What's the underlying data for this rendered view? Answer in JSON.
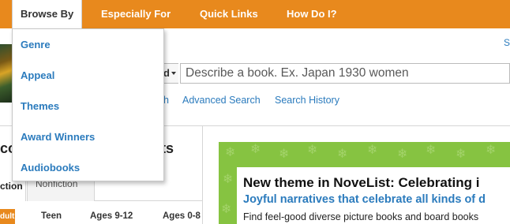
{
  "topnav": {
    "items": [
      {
        "label": "Browse By"
      },
      {
        "label": "Especially For"
      },
      {
        "label": "Quick Links"
      },
      {
        "label": "How Do I?"
      }
    ]
  },
  "header": {
    "sign_fragment": "S"
  },
  "search": {
    "type_fragment": "d",
    "placeholder": "Describe a book. Ex. Japan 1930 women",
    "fragment_left": "h",
    "advanced_link": "Advanced Search",
    "history_link": "Search History"
  },
  "left_panel": {
    "title_fragment": "co",
    "title_fragment_right": "ts",
    "tabs": [
      {
        "label": "ction"
      },
      {
        "label": "Nonfiction"
      }
    ],
    "age_badge": "dult",
    "age_links": [
      {
        "label": "Teen"
      },
      {
        "label": "Ages 9-12"
      },
      {
        "label": "Ages 0-8"
      }
    ]
  },
  "promo": {
    "title": "New theme in NoveList: Celebrating i",
    "subtitle": "Joyful narratives that celebrate all kinds of d",
    "body": "Find feel-good diverse picture books and board books"
  },
  "dropdown": {
    "items": [
      {
        "label": "Genre"
      },
      {
        "label": "Appeal"
      },
      {
        "label": "Themes"
      },
      {
        "label": "Award Winners"
      },
      {
        "label": "Audiobooks"
      }
    ]
  },
  "colors": {
    "nav_orange": "#e8891d",
    "link_blue": "#2b7bbd",
    "promo_green": "#86c341"
  }
}
